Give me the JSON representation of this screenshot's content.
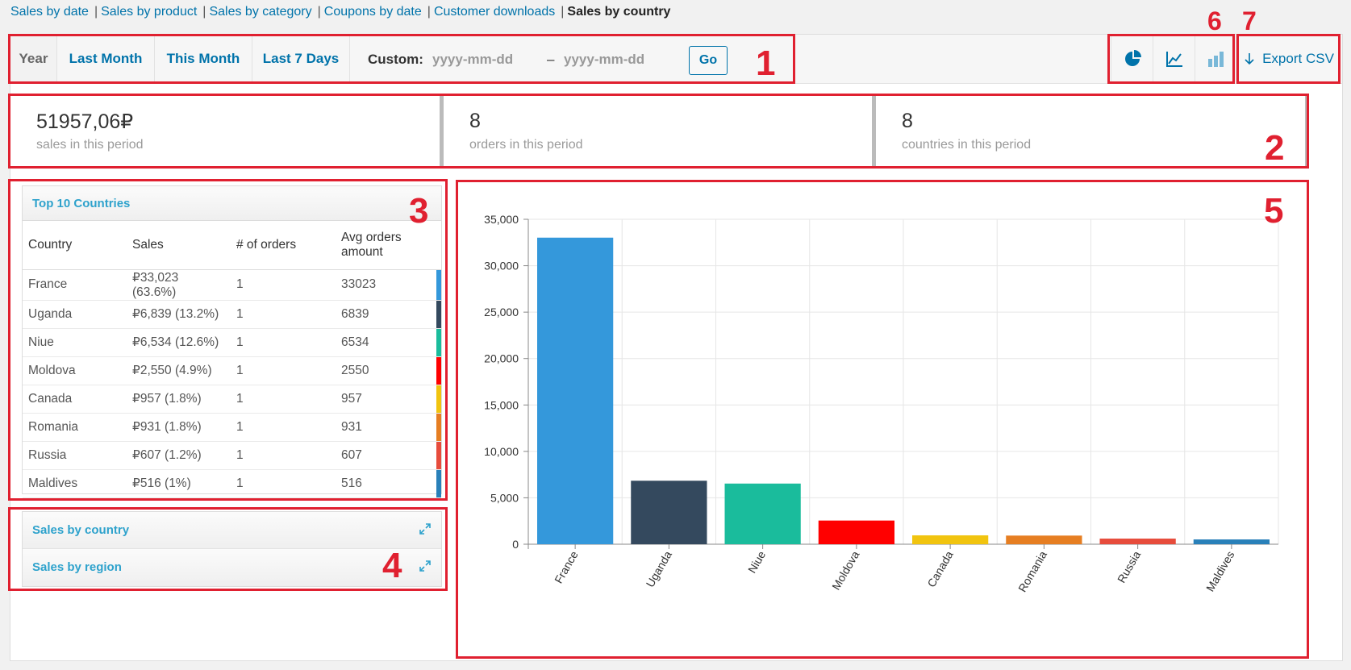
{
  "subnav": {
    "items": [
      "Sales by date",
      "Sales by product",
      "Sales by category",
      "Coupons by date",
      "Customer downloads"
    ],
    "current": "Sales by country"
  },
  "range": {
    "tabs": [
      "Year",
      "Last Month",
      "This Month",
      "Last 7 Days"
    ],
    "active": "Year",
    "custom_label": "Custom:",
    "start_placeholder": "yyyy-mm-dd",
    "end_placeholder": "yyyy-mm-dd",
    "dash": "–",
    "go_label": "Go"
  },
  "chart_types": [
    "pie-chart-icon",
    "line-chart-icon",
    "bar-chart-icon"
  ],
  "export": {
    "label": "Export CSV",
    "icon": "download-arrow-icon"
  },
  "stats": [
    {
      "value": "51957,06₽",
      "label": "sales in this period"
    },
    {
      "value": "8",
      "label": "orders in this period"
    },
    {
      "value": "8",
      "label": "countries in this period"
    }
  ],
  "top_countries": {
    "title": "Top 10 Countries",
    "headers": [
      "Country",
      "Sales",
      "# of orders",
      "Avg orders amount"
    ],
    "rows": [
      {
        "country": "France",
        "sales": "₽33,023 (63.6%)",
        "orders": "1",
        "avg": "33023",
        "color": "#3498db"
      },
      {
        "country": "Uganda",
        "sales": "₽6,839 (13.2%)",
        "orders": "1",
        "avg": "6839",
        "color": "#34495e"
      },
      {
        "country": "Niue",
        "sales": "₽6,534 (12.6%)",
        "orders": "1",
        "avg": "6534",
        "color": "#1abc9c"
      },
      {
        "country": "Moldova",
        "sales": "₽2,550 (4.9%)",
        "orders": "1",
        "avg": "2550",
        "color": "#ff0000"
      },
      {
        "country": "Canada",
        "sales": "₽957 (1.8%)",
        "orders": "1",
        "avg": "957",
        "color": "#f1c40f"
      },
      {
        "country": "Romania",
        "sales": "₽931 (1.8%)",
        "orders": "1",
        "avg": "931",
        "color": "#e67e22"
      },
      {
        "country": "Russia",
        "sales": "₽607 (1.2%)",
        "orders": "1",
        "avg": "607",
        "color": "#e74c3c"
      },
      {
        "country": "Maldives",
        "sales": "₽516 (1%)",
        "orders": "1",
        "avg": "516",
        "color": "#2980b9"
      }
    ]
  },
  "collapsibles": [
    {
      "label": "Sales by country",
      "icon": "expand-icon"
    },
    {
      "label": "Sales by region",
      "icon": "expand-icon"
    }
  ],
  "annotations": [
    "1",
    "2",
    "3",
    "4",
    "5",
    "6",
    "7"
  ],
  "chart_data": {
    "type": "bar",
    "categories": [
      "France",
      "Uganda",
      "Niue",
      "Moldova",
      "Canada",
      "Romania",
      "Russia",
      "Maldives"
    ],
    "values": [
      33023,
      6839,
      6534,
      2550,
      957,
      931,
      607,
      516
    ],
    "colors": [
      "#3498db",
      "#34495e",
      "#1abc9c",
      "#ff0000",
      "#f1c40f",
      "#e67e22",
      "#e74c3c",
      "#2980b9"
    ],
    "ylim": [
      0,
      35000
    ],
    "yticks": [
      0,
      5000,
      10000,
      15000,
      20000,
      25000,
      30000,
      35000
    ],
    "ytick_labels": [
      "0",
      "5,000",
      "10,000",
      "15,000",
      "20,000",
      "25,000",
      "30,000",
      "35,000"
    ],
    "grid": true,
    "title": "",
    "xlabel": "",
    "ylabel": ""
  }
}
